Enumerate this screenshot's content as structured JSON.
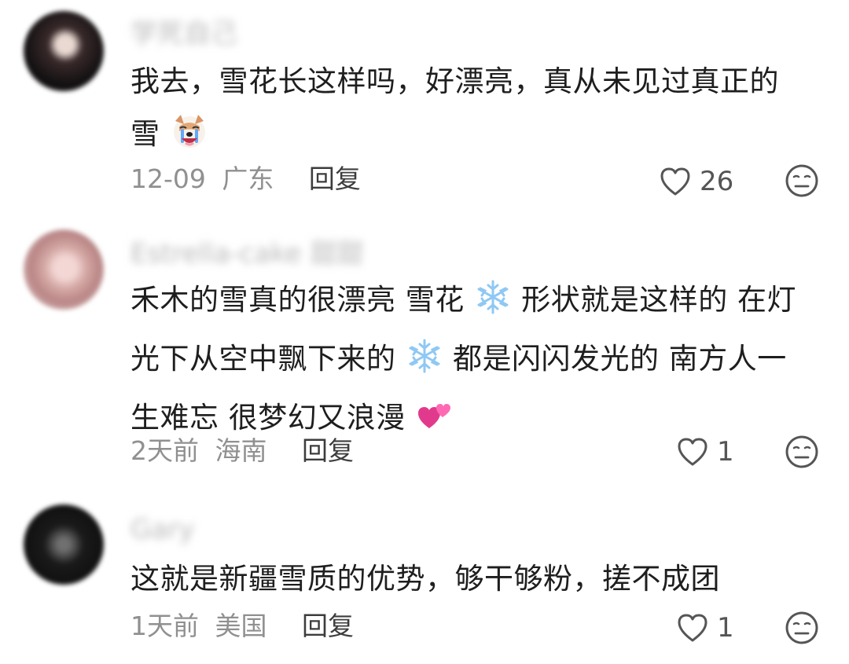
{
  "comments": [
    {
      "username": "学死自己",
      "lines": [
        "我去，雪花长这样吗，好漂亮，真从未见过真正的",
        "雪"
      ],
      "date": "12-09",
      "region": "广东",
      "reply_label": "回复",
      "like_count": "26",
      "emoji": "crying-dog-icon"
    },
    {
      "username": "Estrella-cake 甜甜",
      "line1_a": "禾木的雪真的很漂亮 雪花",
      "line1_b": "形状就是这样的 在灯",
      "line2_a": "光下从空中飘下来的",
      "line2_b": "都是闪闪发光的  南方人一",
      "line3_a": "生难忘 很梦幻又浪漫",
      "date": "2天前",
      "region": "海南",
      "reply_label": "回复",
      "like_count": "1",
      "emoji": [
        "snowflake-icon",
        "snowflake-icon",
        "two-hearts-icon"
      ]
    },
    {
      "username": "Gary",
      "lines": [
        "这就是新疆雪质的优势，够干够粉，搓不成团"
      ],
      "date": "1天前",
      "region": "美国",
      "reply_label": "回复",
      "like_count": "1"
    }
  ],
  "colors": {
    "text": "#1e1e1e",
    "meta": "#909090",
    "reply": "#3d3d3d",
    "icon": "#555555"
  }
}
